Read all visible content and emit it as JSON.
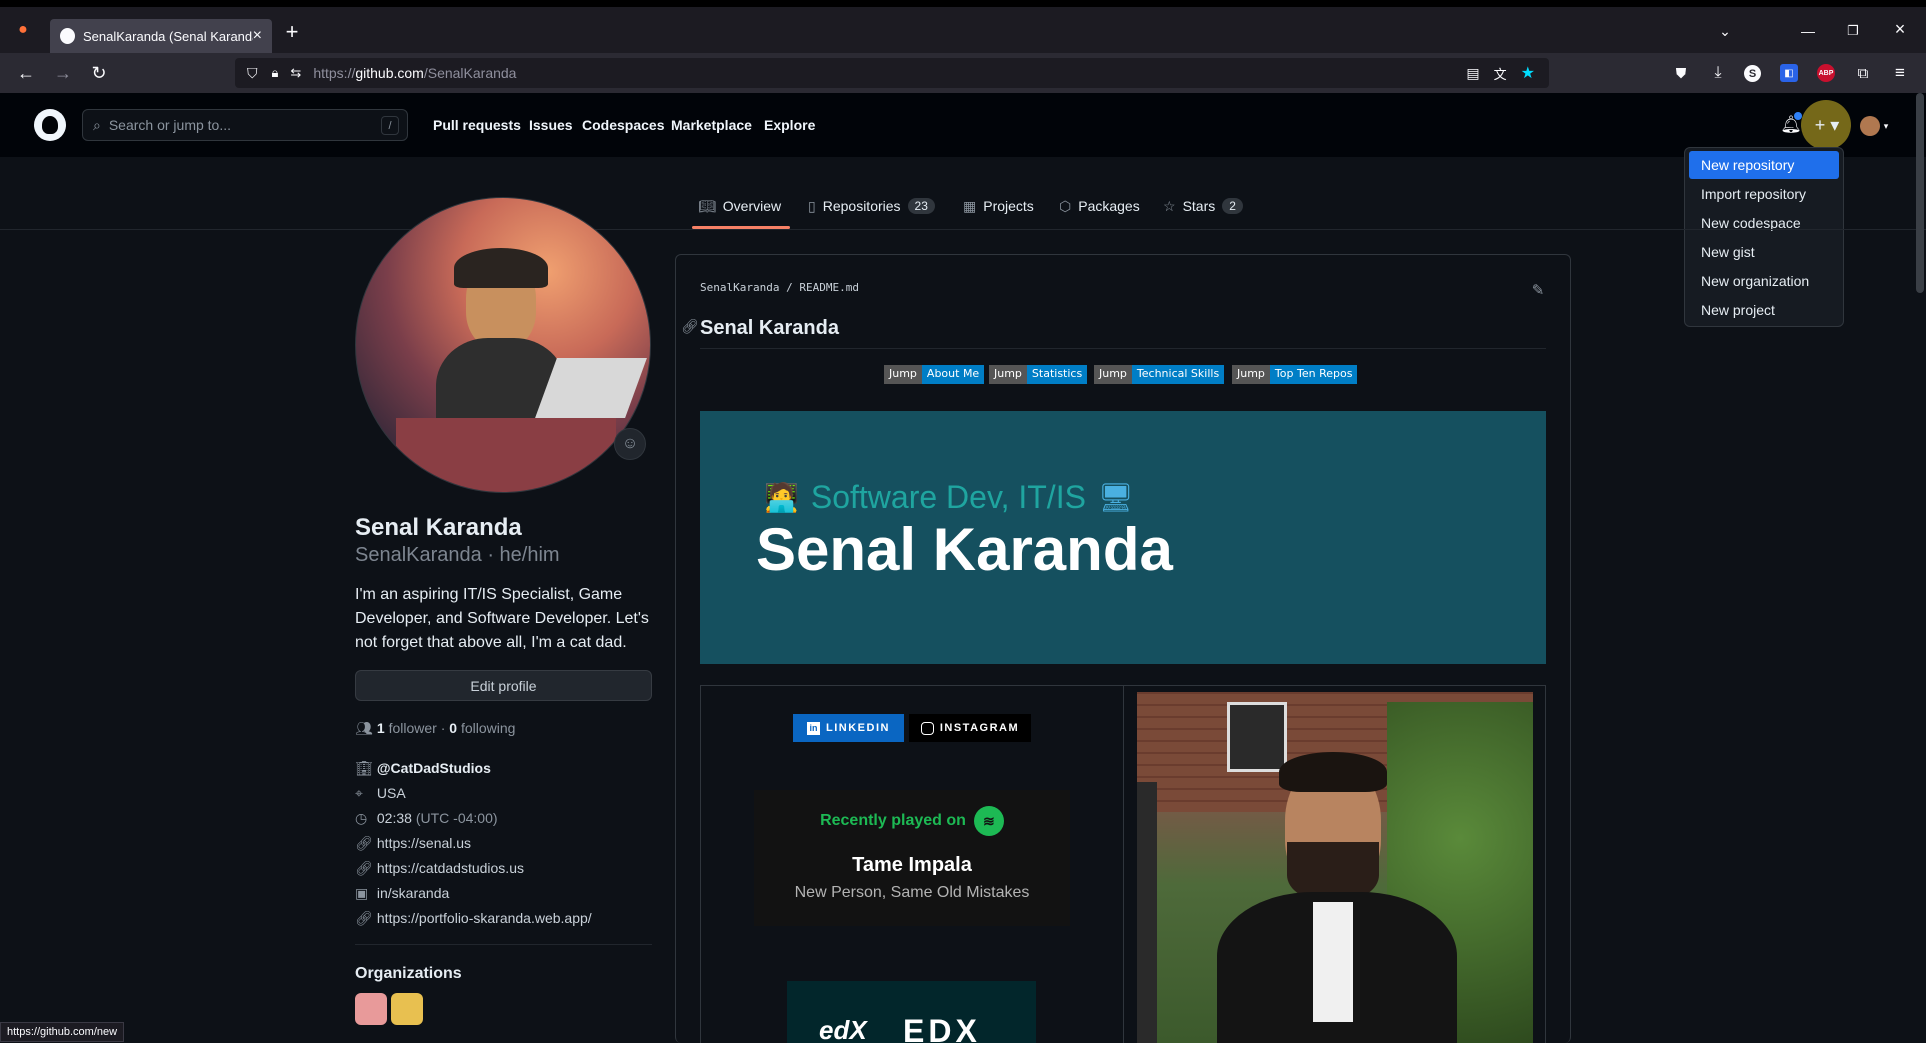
{
  "browser": {
    "tab_title": "SenalKaranda (Senal Karanda)",
    "url_protocol": "https://",
    "url_host": "github.com",
    "url_path": "/SenalKaranda",
    "status_url": "https://github.com/new"
  },
  "github": {
    "search_placeholder": "Search or jump to...",
    "search_shortcut": "/",
    "nav": [
      "Pull requests",
      "Issues",
      "Codespaces",
      "Marketplace",
      "Explore"
    ],
    "create_menu": [
      "New repository",
      "Import repository",
      "New codespace",
      "New gist",
      "New organization",
      "New project"
    ]
  },
  "profile_tabs": {
    "overview": "Overview",
    "repositories": "Repositories",
    "repositories_count": "23",
    "projects": "Projects",
    "packages": "Packages",
    "stars": "Stars",
    "stars_count": "2"
  },
  "profile": {
    "name": "Senal Karanda",
    "login_pronouns": "SenalKaranda · he/him",
    "bio": "I'm an aspiring IT/IS Specialist, Game Developer, and Software Developer. Let's not forget that above all, I'm a cat dad.",
    "edit_button": "Edit profile",
    "followers_count": "1",
    "followers_label": "follower",
    "separator": "·",
    "following_count": "0",
    "following_label": "following",
    "company": "@CatDadStudios",
    "location": "USA",
    "time": "02:38",
    "timezone": "(UTC -04:00)",
    "link1": "https://senal.us",
    "link2": "https://catdadstudios.us",
    "linkedin": "in/skaranda",
    "link3": "https://portfolio-skaranda.web.app/",
    "organizations_heading": "Organizations"
  },
  "readme": {
    "path_user": "SenalKaranda",
    "path_sep": "/",
    "path_file": "README.md",
    "heading": "Senal Karanda",
    "badges": [
      {
        "left": "Jump",
        "right": "About Me"
      },
      {
        "left": "Jump",
        "right": "Statistics"
      },
      {
        "left": "Jump",
        "right": "Technical Skills"
      },
      {
        "left": "Jump",
        "right": "Top Ten Repos"
      }
    ],
    "banner_subtitle": "Software Dev, IT/IS",
    "banner_name": "Senal Karanda",
    "linkedin_btn": "LINKEDIN",
    "instagram_btn": "INSTAGRAM",
    "spotify_label": "Recently played on",
    "song_artist": "Tame Impala",
    "song_title": "New Person, Same Old Mistakes",
    "edx_text": "EDX",
    "edx_logo": "edX"
  },
  "colors": {
    "accent_blue": "#1f6feb",
    "banner_bg": "#15505f",
    "spotify_green": "#1db954",
    "tab_underline": "#f78166"
  }
}
